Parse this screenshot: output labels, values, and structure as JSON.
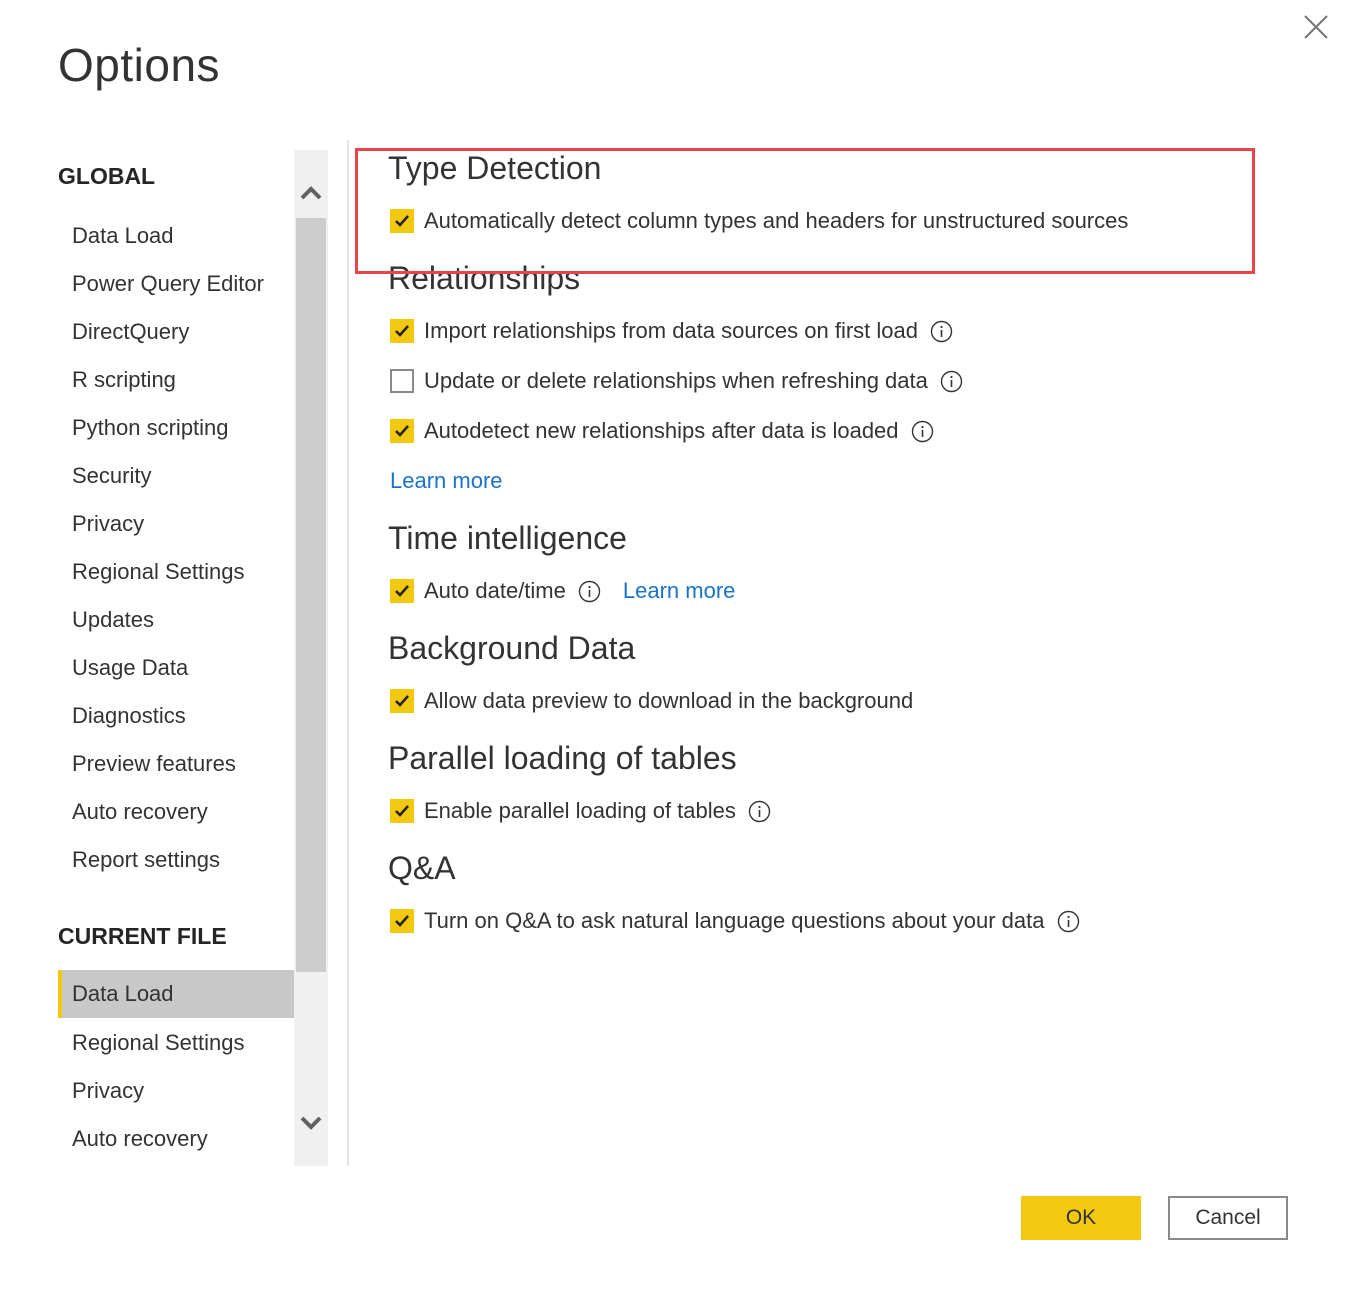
{
  "dialog": {
    "title": "Options",
    "close_icon": "close-icon"
  },
  "sidebar": {
    "global_header": "GLOBAL",
    "global_items": [
      {
        "label": "Data Load"
      },
      {
        "label": "Power Query Editor"
      },
      {
        "label": "DirectQuery"
      },
      {
        "label": "R scripting"
      },
      {
        "label": "Python scripting"
      },
      {
        "label": "Security"
      },
      {
        "label": "Privacy"
      },
      {
        "label": "Regional Settings"
      },
      {
        "label": "Updates"
      },
      {
        "label": "Usage Data"
      },
      {
        "label": "Diagnostics"
      },
      {
        "label": "Preview features"
      },
      {
        "label": "Auto recovery"
      },
      {
        "label": "Report settings"
      }
    ],
    "current_file_header": "CURRENT FILE",
    "current_file_items": [
      {
        "label": "Data Load",
        "selected": true
      },
      {
        "label": "Regional Settings",
        "selected": false
      },
      {
        "label": "Privacy",
        "selected": false
      },
      {
        "label": "Auto recovery",
        "selected": false
      }
    ],
    "accent_color": "#f2c811"
  },
  "scrollbar": {
    "up_icon": "chevron-up-icon",
    "down_icon": "chevron-down-icon"
  },
  "content": {
    "type_detection": {
      "title": "Type Detection",
      "options": [
        {
          "label": "Automatically detect column types and headers for unstructured sources",
          "checked": true,
          "info": false
        }
      ]
    },
    "relationships": {
      "title": "Relationships",
      "options": [
        {
          "label": "Import relationships from data sources on first load",
          "checked": true,
          "info": true
        },
        {
          "label": "Update or delete relationships when refreshing data",
          "checked": false,
          "info": true
        },
        {
          "label": "Autodetect new relationships after data is loaded",
          "checked": true,
          "info": true
        }
      ],
      "learn_more": "Learn more"
    },
    "time_intelligence": {
      "title": "Time intelligence",
      "options": [
        {
          "label": "Auto date/time",
          "checked": true,
          "info": true
        }
      ],
      "learn_more": "Learn more"
    },
    "background_data": {
      "title": "Background Data",
      "options": [
        {
          "label": "Allow data preview to download in the background",
          "checked": true,
          "info": false
        }
      ]
    },
    "parallel_loading": {
      "title": "Parallel loading of tables",
      "options": [
        {
          "label": "Enable parallel loading of tables",
          "checked": true,
          "info": true
        }
      ]
    },
    "qna": {
      "title": "Q&A",
      "options": [
        {
          "label": "Turn on Q&A to ask natural language questions about your data",
          "checked": true,
          "info": true
        }
      ]
    }
  },
  "footer": {
    "ok_label": "OK",
    "cancel_label": "Cancel"
  },
  "colors": {
    "checkbox_checked": "#f2c811",
    "link": "#1a73c8",
    "highlight_border": "#e8444a"
  }
}
